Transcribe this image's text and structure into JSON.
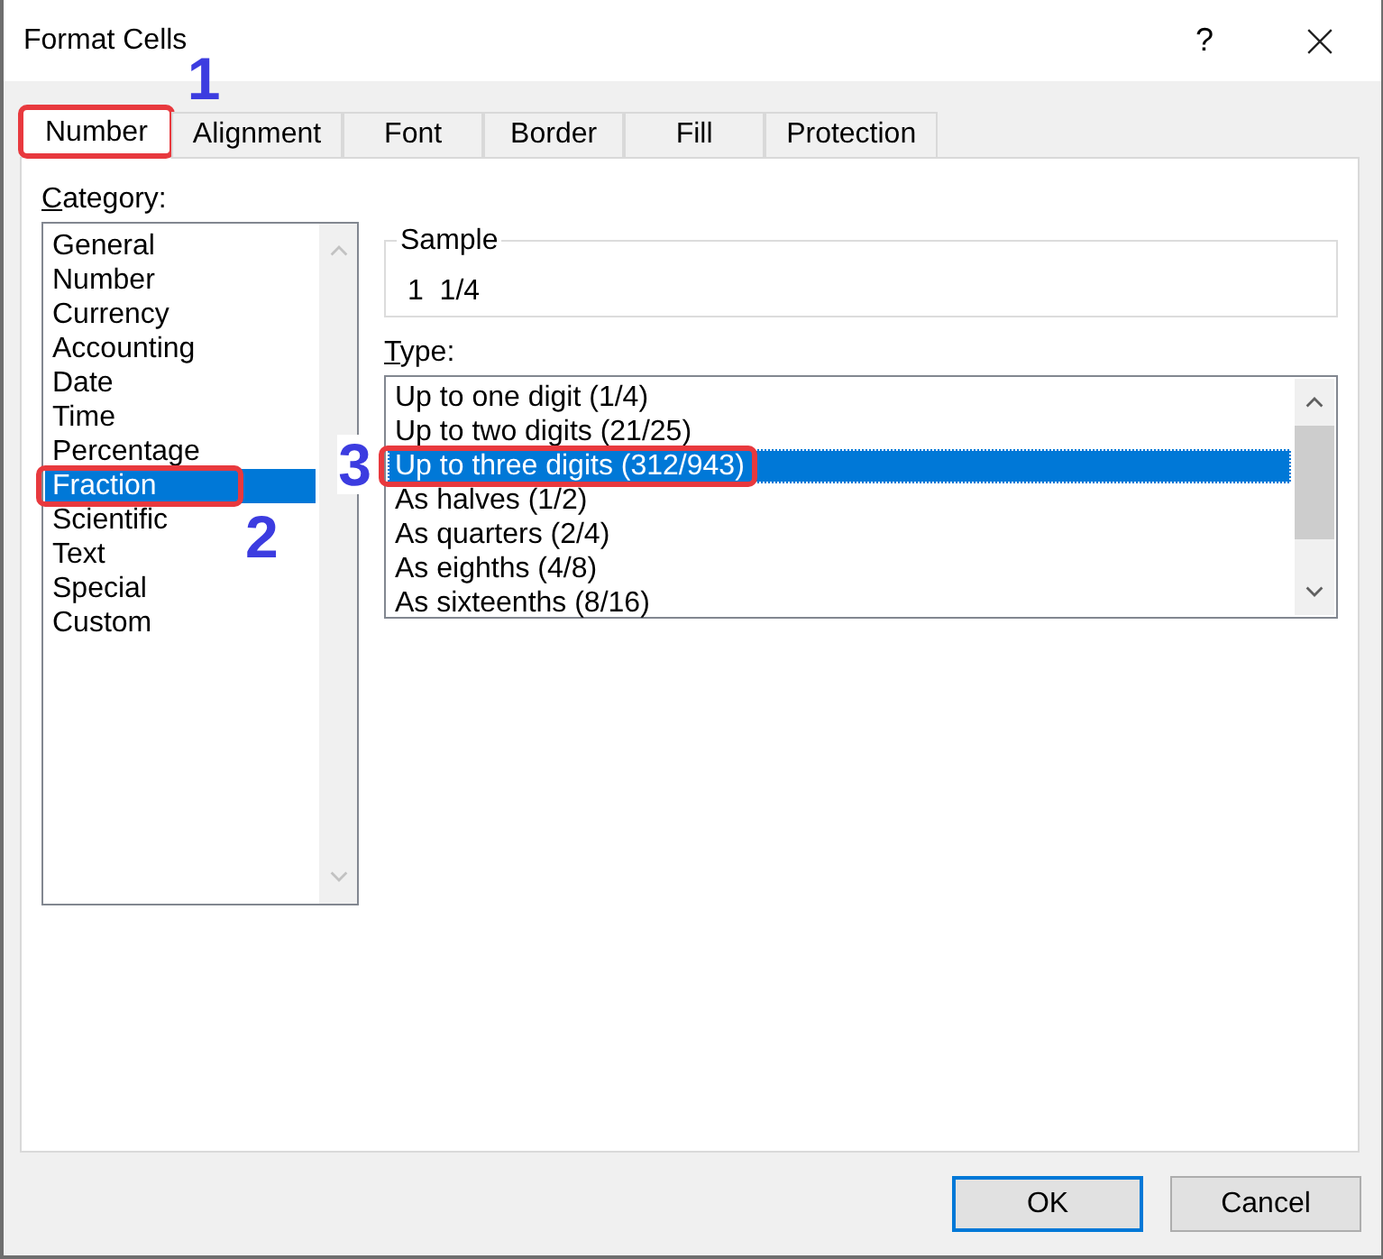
{
  "window": {
    "title": "Format Cells",
    "help": "?"
  },
  "tabs": [
    {
      "label": "Number",
      "selected": true,
      "highlighted": true,
      "callout": "1"
    },
    {
      "label": "Alignment",
      "selected": false,
      "highlighted": false
    },
    {
      "label": "Font",
      "selected": false,
      "highlighted": false
    },
    {
      "label": "Border",
      "selected": false,
      "highlighted": false
    },
    {
      "label": "Fill",
      "selected": false,
      "highlighted": false
    },
    {
      "label": "Protection",
      "selected": false,
      "highlighted": false
    }
  ],
  "category": {
    "label": "Category:",
    "items": [
      {
        "label": "General",
        "selected": false,
        "highlighted": false
      },
      {
        "label": "Number",
        "selected": false,
        "highlighted": false
      },
      {
        "label": "Currency",
        "selected": false,
        "highlighted": false
      },
      {
        "label": "Accounting",
        "selected": false,
        "highlighted": false
      },
      {
        "label": "Date",
        "selected": false,
        "highlighted": false
      },
      {
        "label": "Time",
        "selected": false,
        "highlighted": false
      },
      {
        "label": "Percentage",
        "selected": false,
        "highlighted": false
      },
      {
        "label": "Fraction",
        "selected": true,
        "highlighted": true,
        "callout": "2"
      },
      {
        "label": "Scientific",
        "selected": false,
        "highlighted": false
      },
      {
        "label": "Text",
        "selected": false,
        "highlighted": false
      },
      {
        "label": "Special",
        "selected": false,
        "highlighted": false
      },
      {
        "label": "Custom",
        "selected": false,
        "highlighted": false
      }
    ]
  },
  "sample": {
    "legend": "Sample",
    "value": "1  1/4"
  },
  "type": {
    "label": "Type:",
    "items": [
      {
        "label": "Up to one digit (1/4)",
        "selected": false,
        "highlighted": false
      },
      {
        "label": "Up to two digits (21/25)",
        "selected": false,
        "highlighted": false
      },
      {
        "label": "Up to three digits (312/943)",
        "selected": true,
        "highlighted": true,
        "callout": "3"
      },
      {
        "label": "As halves (1/2)",
        "selected": false,
        "highlighted": false
      },
      {
        "label": "As quarters (2/4)",
        "selected": false,
        "highlighted": false
      },
      {
        "label": "As eighths (4/8)",
        "selected": false,
        "highlighted": false
      },
      {
        "label": "As sixteenths (8/16)",
        "selected": false,
        "highlighted": false
      }
    ]
  },
  "buttons": [
    {
      "label": "OK",
      "default": true
    },
    {
      "label": "Cancel",
      "default": false
    }
  ]
}
